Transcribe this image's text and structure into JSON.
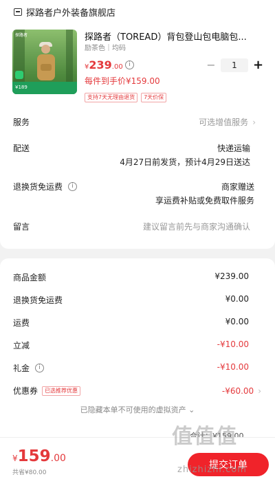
{
  "store": {
    "name": "探路者户外装备旗舰店"
  },
  "product": {
    "title": "探路者（TOREAD）背包登山包电脑包...",
    "spec": "励茶色｜均码",
    "price": {
      "currency": "¥",
      "integer": "239",
      "decimal": ".00"
    },
    "net_price": "每件到手价¥159.00",
    "tags": [
      "支持7天无理由退货",
      "7天价保"
    ],
    "thumbnail": {
      "logo": "探路者",
      "badge_price": "¥189"
    },
    "quantity": "1"
  },
  "services": {
    "service": {
      "label": "服务",
      "value": "可选增值服务"
    },
    "delivery": {
      "label": "配送",
      "value": "快递运输",
      "detail": "4月27日前发货，预计4月29日送达"
    },
    "return_shipping": {
      "label": "退换货免运费",
      "value": "商家赠送",
      "detail": "享运费补贴或免费取件服务"
    },
    "message": {
      "label": "留言",
      "placeholder": "建议留言前先与商家沟通确认"
    }
  },
  "amounts": {
    "goods": {
      "label": "商品金额",
      "value": "¥239.00"
    },
    "return_shipping": {
      "label": "退换货免运费",
      "value": "¥0.00"
    },
    "shipping": {
      "label": "运费",
      "value": "¥0.00"
    },
    "instant_discount": {
      "label": "立减",
      "value": "-¥10.00"
    },
    "gift_money": {
      "label": "礼金",
      "value": "-¥10.00"
    },
    "coupon": {
      "label": "优惠券",
      "tag": "已选推荐优惠",
      "value": "-¥60.00"
    }
  },
  "hidden_assets": "已隐藏本单不可使用的虚拟资产 ⌄",
  "footer": {
    "total": {
      "currency": "¥",
      "integer": "159",
      "decimal": ".00"
    },
    "saved": "共省¥80.00",
    "subtotal_peek": "合计：¥159.00",
    "submit_label": "提交订单"
  },
  "watermark": {
    "text": "值值值",
    "url": "zhizhizhi.com"
  },
  "colors": {
    "accent": "#e4393c",
    "button": "#f0232a"
  }
}
